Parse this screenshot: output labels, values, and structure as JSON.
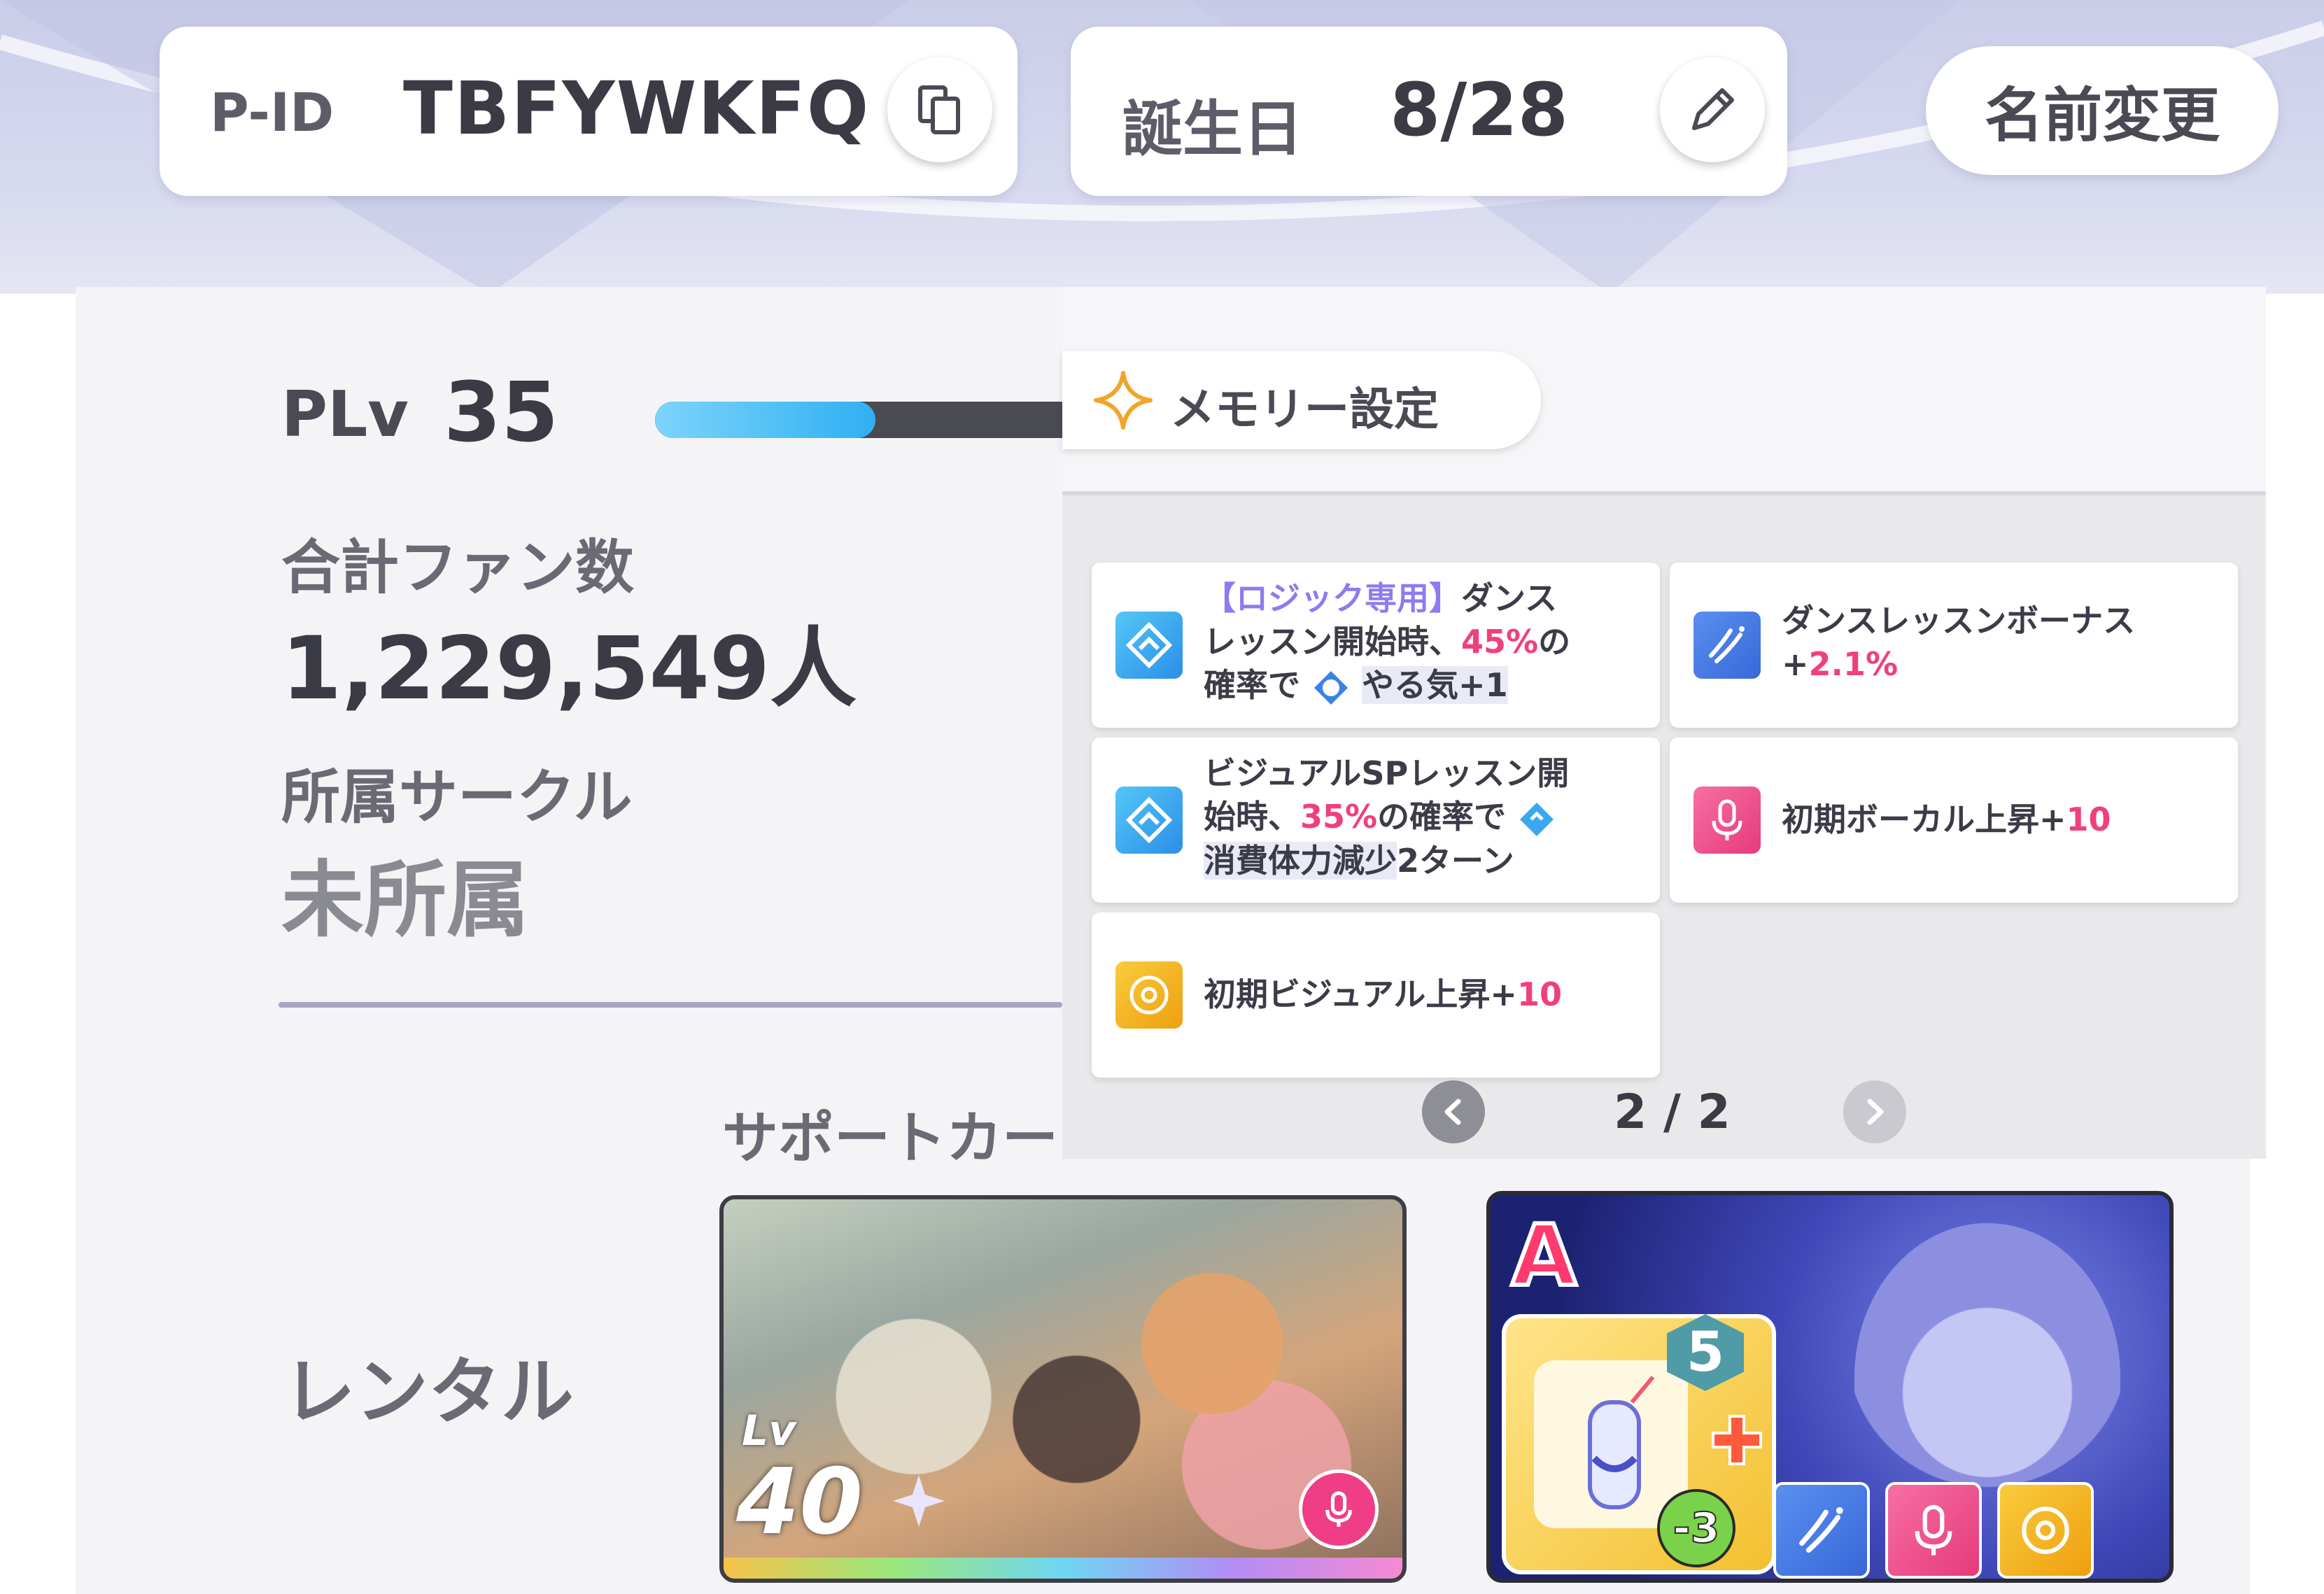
{
  "header": {
    "pid_label": "P-ID",
    "pid_value": "TBFYWKFQ",
    "birthday_label": "誕生日",
    "birthday_value": "8/28",
    "rename_button": "名前変更"
  },
  "profile": {
    "plv_label": "PLv",
    "plv_value": "35",
    "plv_progress": 0.5,
    "fans_label": "合計ファン数",
    "fans_value": "1,229,549人",
    "circle_label": "所属サークル",
    "circle_value": "未所属",
    "support_label": "サポートカー",
    "rental_label": "レンタル"
  },
  "memory_popup": {
    "title": "メモリー設定",
    "page_indicator": "2 / 2",
    "skills": [
      {
        "icon": "diamond-skill-icon",
        "parts": [
          "【ロジック専用】",
          "ダンス",
          "レッスン開始時、",
          "45%",
          "の",
          "確率で",
          "やる気+1"
        ]
      },
      {
        "icon": "dance-bonus-icon",
        "parts": [
          "ダンスレッスンボーナス",
          "+",
          "2.1%"
        ]
      },
      {
        "icon": "diamond-skill-icon",
        "parts": [
          "ビジュアルSPレッスン開",
          "始時、",
          "35%",
          "の確率で",
          "消費体力減少",
          "2ターン"
        ]
      },
      {
        "icon": "microphone-icon",
        "parts": [
          "初期ボーカル上昇+",
          "10"
        ]
      },
      {
        "icon": "visual-icon",
        "parts": [
          "初期ビジュアル上昇+",
          "10"
        ]
      }
    ]
  },
  "rental_card": {
    "lv_label": "Lv",
    "lv_value": "40",
    "type_icon": "microphone-icon"
  },
  "memory_card": {
    "rank": "A",
    "level_badge": "5",
    "cost_badge": "-3",
    "skill_icons": [
      "dance-bonus-icon",
      "microphone-icon",
      "visual-icon"
    ]
  },
  "colors": {
    "accent_pink": "#f0407a",
    "accent_violet": "#8c7cf0",
    "progress_blue": "#3db8f5",
    "icon_blue": "#33a6ee",
    "icon_pink": "#f25590",
    "icon_yellow": "#f5b518"
  }
}
